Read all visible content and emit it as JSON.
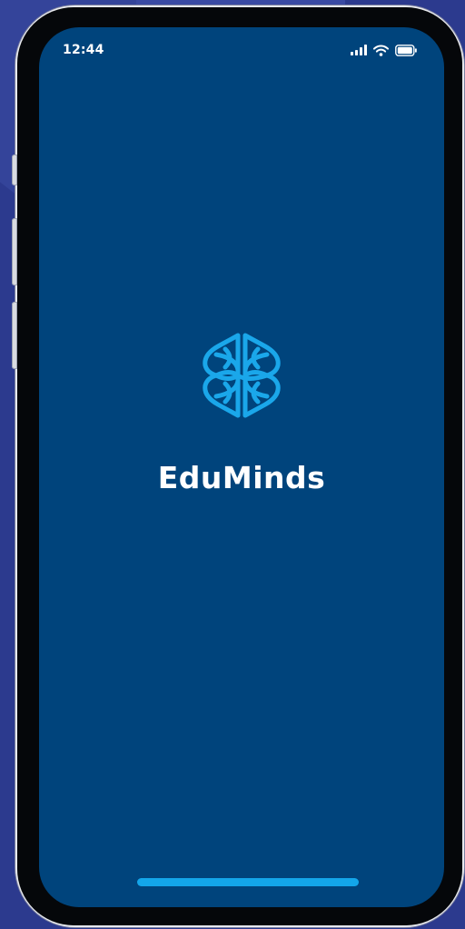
{
  "status_bar": {
    "time": "12:44",
    "icons": [
      "signal-icon",
      "wifi-icon",
      "battery-icon"
    ]
  },
  "splash": {
    "logo_icon": "brain-knot-icon",
    "app_name": "EduMinds"
  },
  "colors": {
    "screen_background": "#00447c",
    "logo_accent": "#1aa7ea",
    "home_indicator": "#13a6ea",
    "text": "#ffffff",
    "backdrop": "#2c3a8e"
  }
}
